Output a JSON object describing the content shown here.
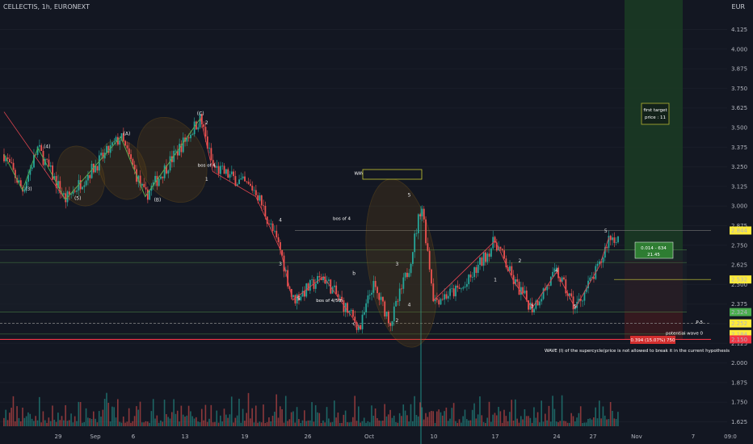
{
  "header": {
    "symbol_line": "CELLECTIS, 1h, EURONEXT",
    "currency": "EUR"
  },
  "colors": {
    "bg": "#131722",
    "up": "#26a69a",
    "down": "#ef5350",
    "wave": "#ff9800",
    "grid": "#1e222d"
  },
  "chart_data": {
    "type": "candlestick",
    "ylim": [
      1.6,
      4.2
    ],
    "y_ticks": [
      "4.125",
      "4.000",
      "3.875",
      "3.750",
      "3.625",
      "3.500",
      "3.375",
      "3.250",
      "3.125",
      "3.000",
      "2.875",
      "2.750",
      "2.625",
      "2.500",
      "2.375",
      "2.250",
      "2.125",
      "2.000",
      "1.875",
      "1.750",
      "1.625"
    ],
    "x_ticks": [
      "29",
      "Sep",
      "6",
      "13",
      "19",
      "26",
      "Oct",
      "10",
      "17",
      "24",
      "27",
      "Nov",
      "7",
      "09:0"
    ],
    "price_levels": [
      {
        "label": "2.844",
        "value": 2.844,
        "color": "#ffeb3b"
      },
      {
        "label": "2.532",
        "value": 2.532,
        "color": "#ffeb3b"
      },
      {
        "label": "2.324",
        "value": 2.324,
        "color": "#4caf50"
      },
      {
        "label": "2.252",
        "value": 2.252,
        "color": "#ffeb3b"
      },
      {
        "label": "2.184",
        "value": 2.184,
        "color": "#ffeb3b"
      },
      {
        "label": "2.150",
        "value": 2.15,
        "color": "#f23645"
      }
    ],
    "wave_labels": [
      {
        "text": "(4)",
        "t": 0.07,
        "v": 3.37
      },
      {
        "text": "(3)",
        "t": 0.04,
        "v": 3.1
      },
      {
        "text": "(5)",
        "t": 0.12,
        "v": 3.04
      },
      {
        "text": "(A)",
        "t": 0.2,
        "v": 3.45
      },
      {
        "text": "(B)",
        "t": 0.25,
        "v": 3.03
      },
      {
        "text": "(C)",
        "t": 0.32,
        "v": 3.58
      },
      {
        "text": "2",
        "t": 0.33,
        "v": 3.52
      },
      {
        "text": "1",
        "t": 0.33,
        "v": 3.16
      },
      {
        "text": "4",
        "t": 0.45,
        "v": 2.9
      },
      {
        "text": "3",
        "t": 0.45,
        "v": 2.62
      },
      {
        "text": "5",
        "t": 0.48,
        "v": 2.4
      },
      {
        "text": "b",
        "t": 0.57,
        "v": 2.56
      },
      {
        "text": "c",
        "t": 0.57,
        "v": 2.24
      },
      {
        "text": "5",
        "t": 0.66,
        "v": 3.06
      },
      {
        "text": "3",
        "t": 0.64,
        "v": 2.62
      },
      {
        "text": "4",
        "t": 0.66,
        "v": 2.36
      },
      {
        "text": "2",
        "t": 0.64,
        "v": 2.26
      },
      {
        "text": "1",
        "t": 0.8,
        "v": 2.52
      },
      {
        "text": "2",
        "t": 0.84,
        "v": 2.64
      },
      {
        "text": "3",
        "t": 0.86,
        "v": 2.35
      },
      {
        "text": "4",
        "t": 0.9,
        "v": 2.58
      },
      {
        "text": "5",
        "t": 0.93,
        "v": 2.35
      },
      {
        "text": "5",
        "t": 0.98,
        "v": 2.83
      }
    ],
    "annotations": [
      {
        "text": "bos of 4",
        "t": 0.33,
        "v": 3.25
      },
      {
        "text": "bos of 4",
        "t": 0.55,
        "v": 2.91
      },
      {
        "text": "bos of 4/5th",
        "t": 0.53,
        "v": 2.39
      },
      {
        "text": "WAVE 1 of the new impulse",
        "t": 0.62,
        "v": 3.2
      },
      {
        "text": "potential wave 0",
        "t": 1.12,
        "v": 2.18
      },
      {
        "text": "P-5",
        "t": 1.12,
        "v": 2.25
      }
    ],
    "target_box": {
      "line1": "first target",
      "line2": "price : 11"
    },
    "position_box": {
      "line1": "0.014 - 634",
      "line2": "21.45"
    },
    "risk_box": {
      "text": "0.394 (15.07%) 750"
    },
    "wave_note": "WAVE (I) of the supercycle(price is not allowed to break it in the current hypothesis"
  }
}
